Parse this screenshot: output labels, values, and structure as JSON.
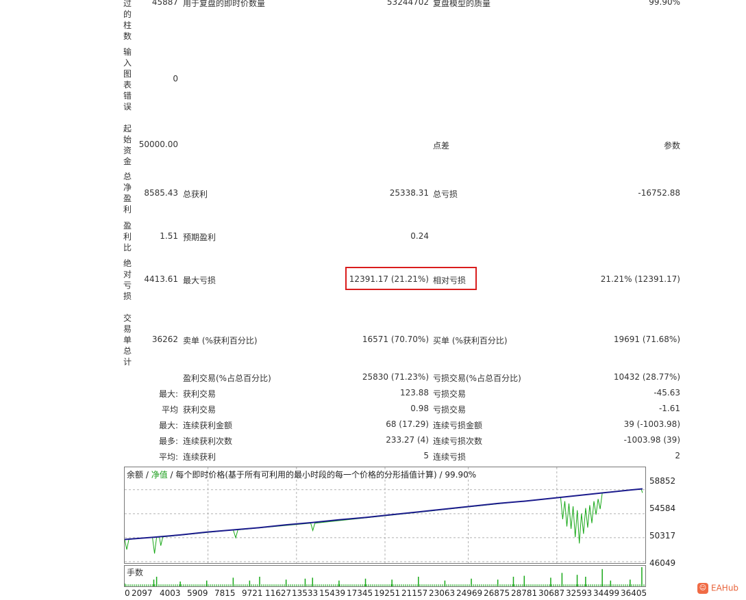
{
  "report": {
    "partial_row": {
      "value": "45887",
      "label": "用于复盘的即时价数量",
      "mid": "53244702",
      "label2": "复盘模型的质量",
      "right": "99.90%"
    },
    "side_labels": [
      {
        "chars": [
          "过",
          "的",
          "柱",
          "数"
        ]
      },
      {
        "chars": [
          "输",
          "入",
          "图",
          "表",
          "错",
          "误"
        ]
      },
      {
        "chars": [
          "起",
          "始",
          "资",
          "金"
        ]
      },
      {
        "chars": [
          "总",
          "净",
          "盈",
          "利"
        ]
      },
      {
        "chars": [
          "盈",
          "利",
          "比"
        ]
      },
      {
        "chars": [
          "绝",
          "对",
          "亏",
          "损"
        ]
      },
      {
        "chars": [
          "交",
          "易",
          "单",
          "总",
          "计"
        ]
      }
    ],
    "rows": [
      {
        "value": "0"
      },
      {
        "value": "50000.00",
        "label2": "点差",
        "right": "参数"
      },
      {
        "value": "8585.43",
        "label": "总获利",
        "mid": "25338.31",
        "label2": "总亏损",
        "right": "-16752.88"
      },
      {
        "value": "1.51",
        "label": "预期盈利",
        "mid": "0.24"
      },
      {
        "value": "4413.61",
        "label": "最大亏损",
        "mid": "12391.17 (21.21%)",
        "label2": "相对亏损",
        "right": "21.21% (12391.17)"
      },
      {
        "value": "36262",
        "label": "卖单 (%获利百分比)",
        "mid": "16571 (70.70%)",
        "label2": "买单 (%获利百分比)",
        "right": "19691 (71.68%)"
      }
    ],
    "stats": [
      {
        "prefix": "",
        "label": "盈利交易(%占总百分比)",
        "mid": "25830 (71.23%)",
        "label2": "亏损交易(%占总百分比)",
        "right": "10432 (28.77%)"
      },
      {
        "prefix": "最大:",
        "label": "获利交易",
        "mid": "123.88",
        "label2": "亏损交易",
        "right": "-45.63"
      },
      {
        "prefix": "平均",
        "label": "获利交易",
        "mid": "0.98",
        "label2": "亏损交易",
        "right": "-1.61"
      },
      {
        "prefix": "最大:",
        "label": "连续获利金额",
        "mid": "68 (17.29)",
        "label2": "连续亏损金额",
        "right": "39 (-1003.98)"
      },
      {
        "prefix": "最多:",
        "label": "连续获利次数",
        "mid": "233.27 (4)",
        "label2": "连续亏损次数",
        "right": "-1003.98 (39)"
      },
      {
        "prefix": "平均:",
        "label": "连续获利",
        "mid": "5",
        "label2": "连续亏损",
        "right": "2"
      }
    ]
  },
  "chart": {
    "title_balance": "余额",
    "title_sep1": " / ",
    "title_equity": "净值",
    "title_rest": " / 每个即时价格(基于所有可利用的最小时段的每一个价格的分形插值计算) / 99.90%",
    "volume_label": "手数",
    "colors": {
      "balance": "#1a1a8c",
      "equity": "#18a818",
      "grid": "#b0b0b0"
    }
  },
  "chart_data": {
    "type": "line",
    "x_ticks": [
      "0",
      "2097",
      "4003",
      "5909",
      "7815",
      "9721",
      "11627",
      "13533",
      "15439",
      "17345",
      "19251",
      "21157",
      "23063",
      "24969",
      "26875",
      "28781",
      "30687",
      "32593",
      "34499",
      "36405"
    ],
    "y_ticks": [
      "58852",
      "54584",
      "50317",
      "46049"
    ],
    "ylim": [
      46049,
      60400
    ],
    "xlim": [
      0,
      37500
    ],
    "series": [
      {
        "name": "余额",
        "points": [
          [
            0,
            50000
          ],
          [
            2097,
            50400
          ],
          [
            4003,
            50800
          ],
          [
            5909,
            51300
          ],
          [
            7815,
            51700
          ],
          [
            9721,
            52100
          ],
          [
            11627,
            52600
          ],
          [
            13533,
            53000
          ],
          [
            15439,
            53500
          ],
          [
            17345,
            53900
          ],
          [
            19251,
            54400
          ],
          [
            21157,
            54900
          ],
          [
            23063,
            55400
          ],
          [
            24969,
            55900
          ],
          [
            26875,
            56400
          ],
          [
            28781,
            56800
          ],
          [
            30687,
            57300
          ],
          [
            32593,
            57800
          ],
          [
            34499,
            58300
          ],
          [
            36405,
            58800
          ],
          [
            37300,
            59000
          ]
        ]
      },
      {
        "name": "净值",
        "points": [
          [
            0,
            50000
          ],
          [
            150,
            48200
          ],
          [
            300,
            50000
          ],
          [
            2000,
            50400
          ],
          [
            2150,
            47500
          ],
          [
            2300,
            50400
          ],
          [
            2500,
            50450
          ],
          [
            2600,
            48900
          ],
          [
            2750,
            50450
          ],
          [
            7815,
            51700
          ],
          [
            8000,
            50300
          ],
          [
            8150,
            51700
          ],
          [
            13400,
            52900
          ],
          [
            13550,
            51600
          ],
          [
            13700,
            52900
          ],
          [
            31400,
            57500
          ],
          [
            31550,
            53600
          ],
          [
            31700,
            56800
          ],
          [
            31850,
            52300
          ],
          [
            32000,
            56400
          ],
          [
            32150,
            51900
          ],
          [
            32300,
            55900
          ],
          [
            32450,
            50400
          ],
          [
            32600,
            55200
          ],
          [
            32750,
            49300
          ],
          [
            32900,
            54600
          ],
          [
            33050,
            51000
          ],
          [
            33200,
            55600
          ],
          [
            33350,
            52100
          ],
          [
            33500,
            56100
          ],
          [
            33650,
            52900
          ],
          [
            33800,
            56800
          ],
          [
            33950,
            54400
          ],
          [
            34100,
            57200
          ],
          [
            34250,
            55400
          ],
          [
            34400,
            58300
          ],
          [
            36405,
            58800
          ],
          [
            37200,
            59000
          ],
          [
            37300,
            58300
          ]
        ]
      }
    ],
    "volume_spikes": [
      [
        0,
        0.15
      ],
      [
        2097,
        0.35
      ],
      [
        2300,
        0.5
      ],
      [
        4003,
        0.25
      ],
      [
        5909,
        0.3
      ],
      [
        7815,
        0.45
      ],
      [
        9000,
        0.3
      ],
      [
        9721,
        0.5
      ],
      [
        11627,
        0.35
      ],
      [
        13000,
        0.4
      ],
      [
        13533,
        0.45
      ],
      [
        15439,
        0.3
      ],
      [
        17345,
        0.4
      ],
      [
        19251,
        0.35
      ],
      [
        21157,
        0.5
      ],
      [
        23063,
        0.3
      ],
      [
        24969,
        0.4
      ],
      [
        26875,
        0.35
      ],
      [
        28000,
        0.5
      ],
      [
        28781,
        0.55
      ],
      [
        30687,
        0.45
      ],
      [
        31500,
        0.7
      ],
      [
        32593,
        0.6
      ],
      [
        33200,
        0.5
      ],
      [
        34400,
        0.9
      ],
      [
        35000,
        0.3
      ],
      [
        36405,
        0.35
      ],
      [
        37250,
        1.0
      ]
    ]
  },
  "logo": {
    "text": "EAHub"
  }
}
